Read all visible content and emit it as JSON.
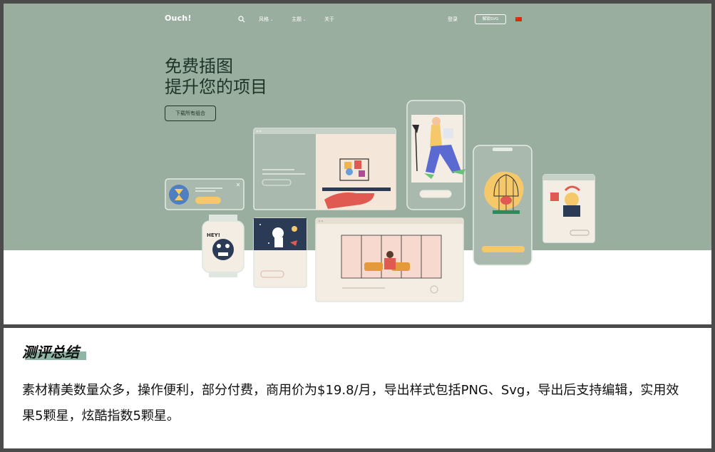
{
  "nav": {
    "logo": "Ouch!",
    "items": [
      {
        "label": "风格",
        "has_dropdown": true
      },
      {
        "label": "主题",
        "has_dropdown": true
      },
      {
        "label": "关于",
        "has_dropdown": false
      }
    ],
    "login": "登录",
    "cta": "解锁SVG",
    "language": "中文"
  },
  "hero": {
    "title_line1": "免费插图",
    "title_line2": "提升您的项目",
    "button": "下载所有组合"
  },
  "illustration_cards": {
    "desktop_card_title": "",
    "fruit_card": "",
    "astronaut_card": "",
    "park_card": ""
  },
  "review": {
    "heading": "测评总结",
    "body": "素材精美数量众多，操作便利，部分付费，商用价为$19.8/月，导出样式包括PNG、Svg，导出后支持编辑，实用效果5颗星，炫酷指数5颗星。"
  },
  "colors": {
    "hero_bg": "#9aae9f",
    "hero_text": "#1c3528",
    "card_bg": "#f4ede4",
    "accent_yellow": "#f5c96a",
    "accent_red": "#e05a52",
    "frame": "#4b4b4b",
    "highlight": "#8fb5a4"
  }
}
